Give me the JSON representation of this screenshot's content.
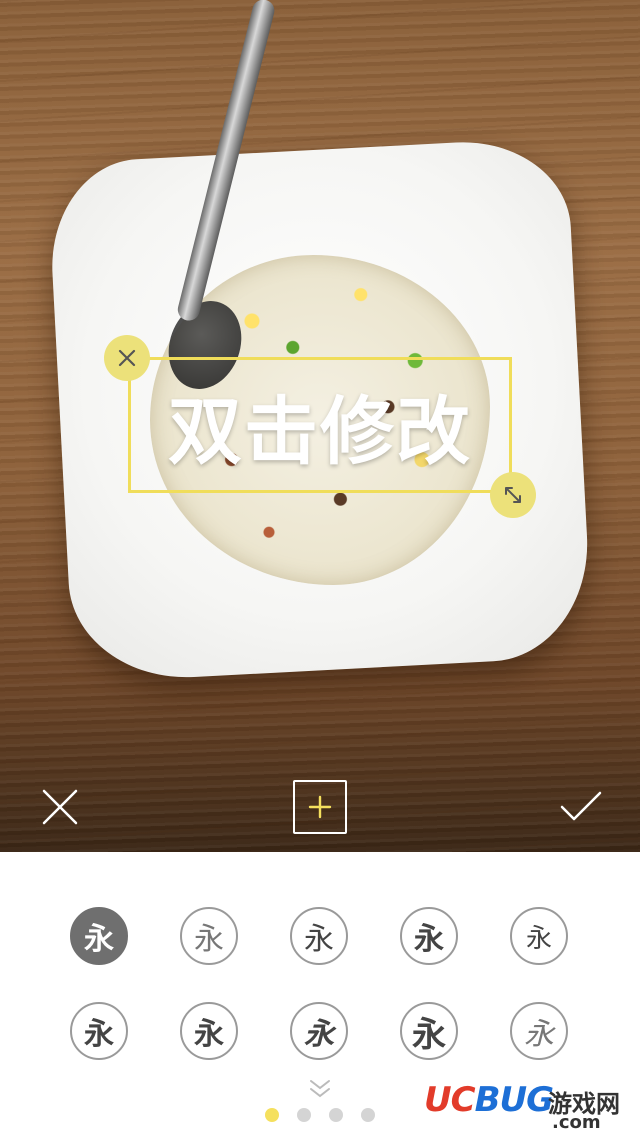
{
  "canvas": {
    "sticker_text": "双击修改"
  },
  "toolbar": {
    "cancel_icon": "close-icon",
    "add_icon": "plus-icon",
    "confirm_icon": "check-icon"
  },
  "fonts": {
    "glyph": "永",
    "selected_index": 0,
    "count": 10
  },
  "pagination": {
    "pages": 4,
    "active": 0
  },
  "watermark": {
    "logo_left": "UC",
    "logo_right": "BUG",
    "site": "游戏网",
    "domain": ".com"
  },
  "colors": {
    "accent": "#f5e05e",
    "selected_font_bg": "#6f6f6f"
  }
}
